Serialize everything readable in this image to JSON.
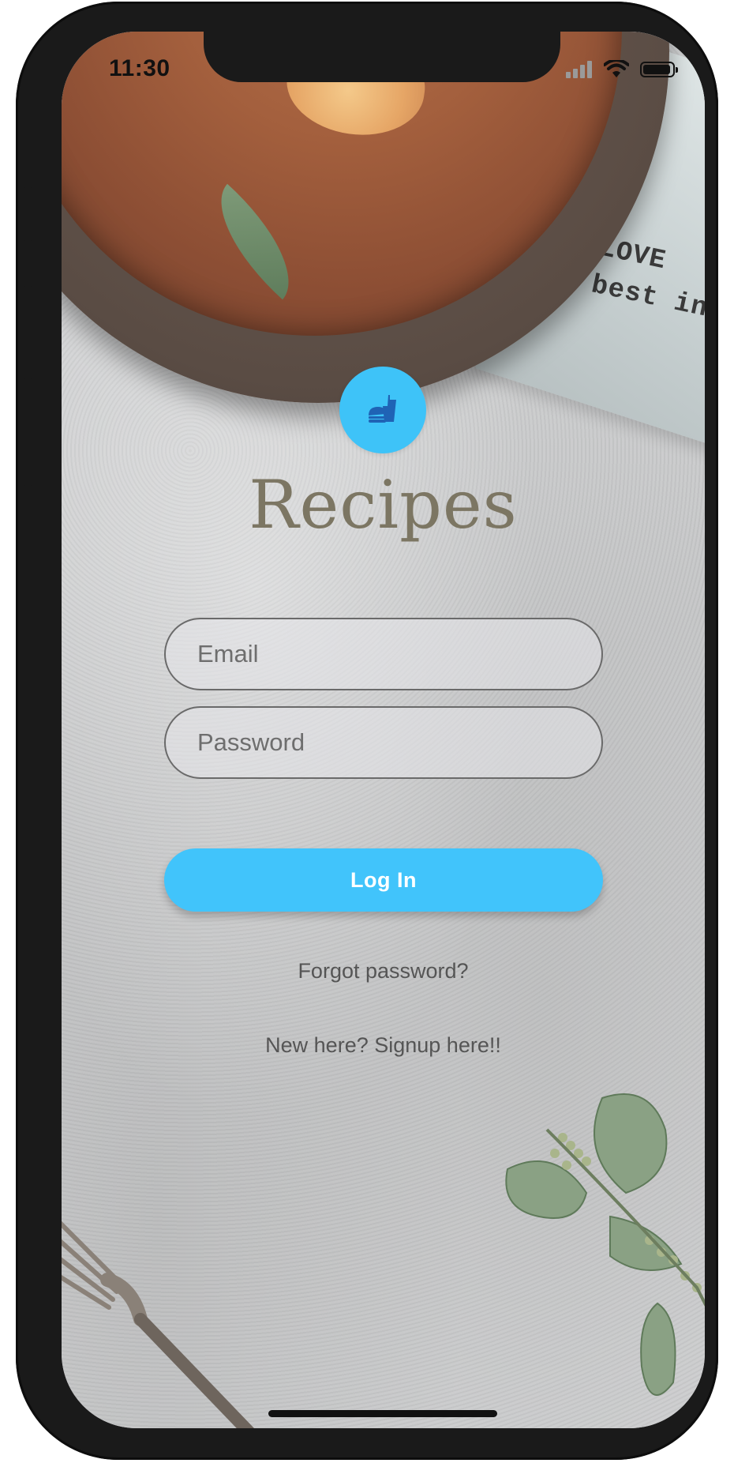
{
  "status_bar": {
    "time": "11:30"
  },
  "app": {
    "title": "Recipes",
    "logo_icon": "fastfood-icon",
    "accent_color": "#41c4fb"
  },
  "form": {
    "email_placeholder": "Email",
    "password_placeholder": "Password",
    "login_label": "Log In"
  },
  "links": {
    "forgot_password": "Forgot password?",
    "signup": "New here? Signup here!!"
  },
  "background": {
    "cloth_text_line1": "LOVE",
    "cloth_text_line2": "best in"
  }
}
